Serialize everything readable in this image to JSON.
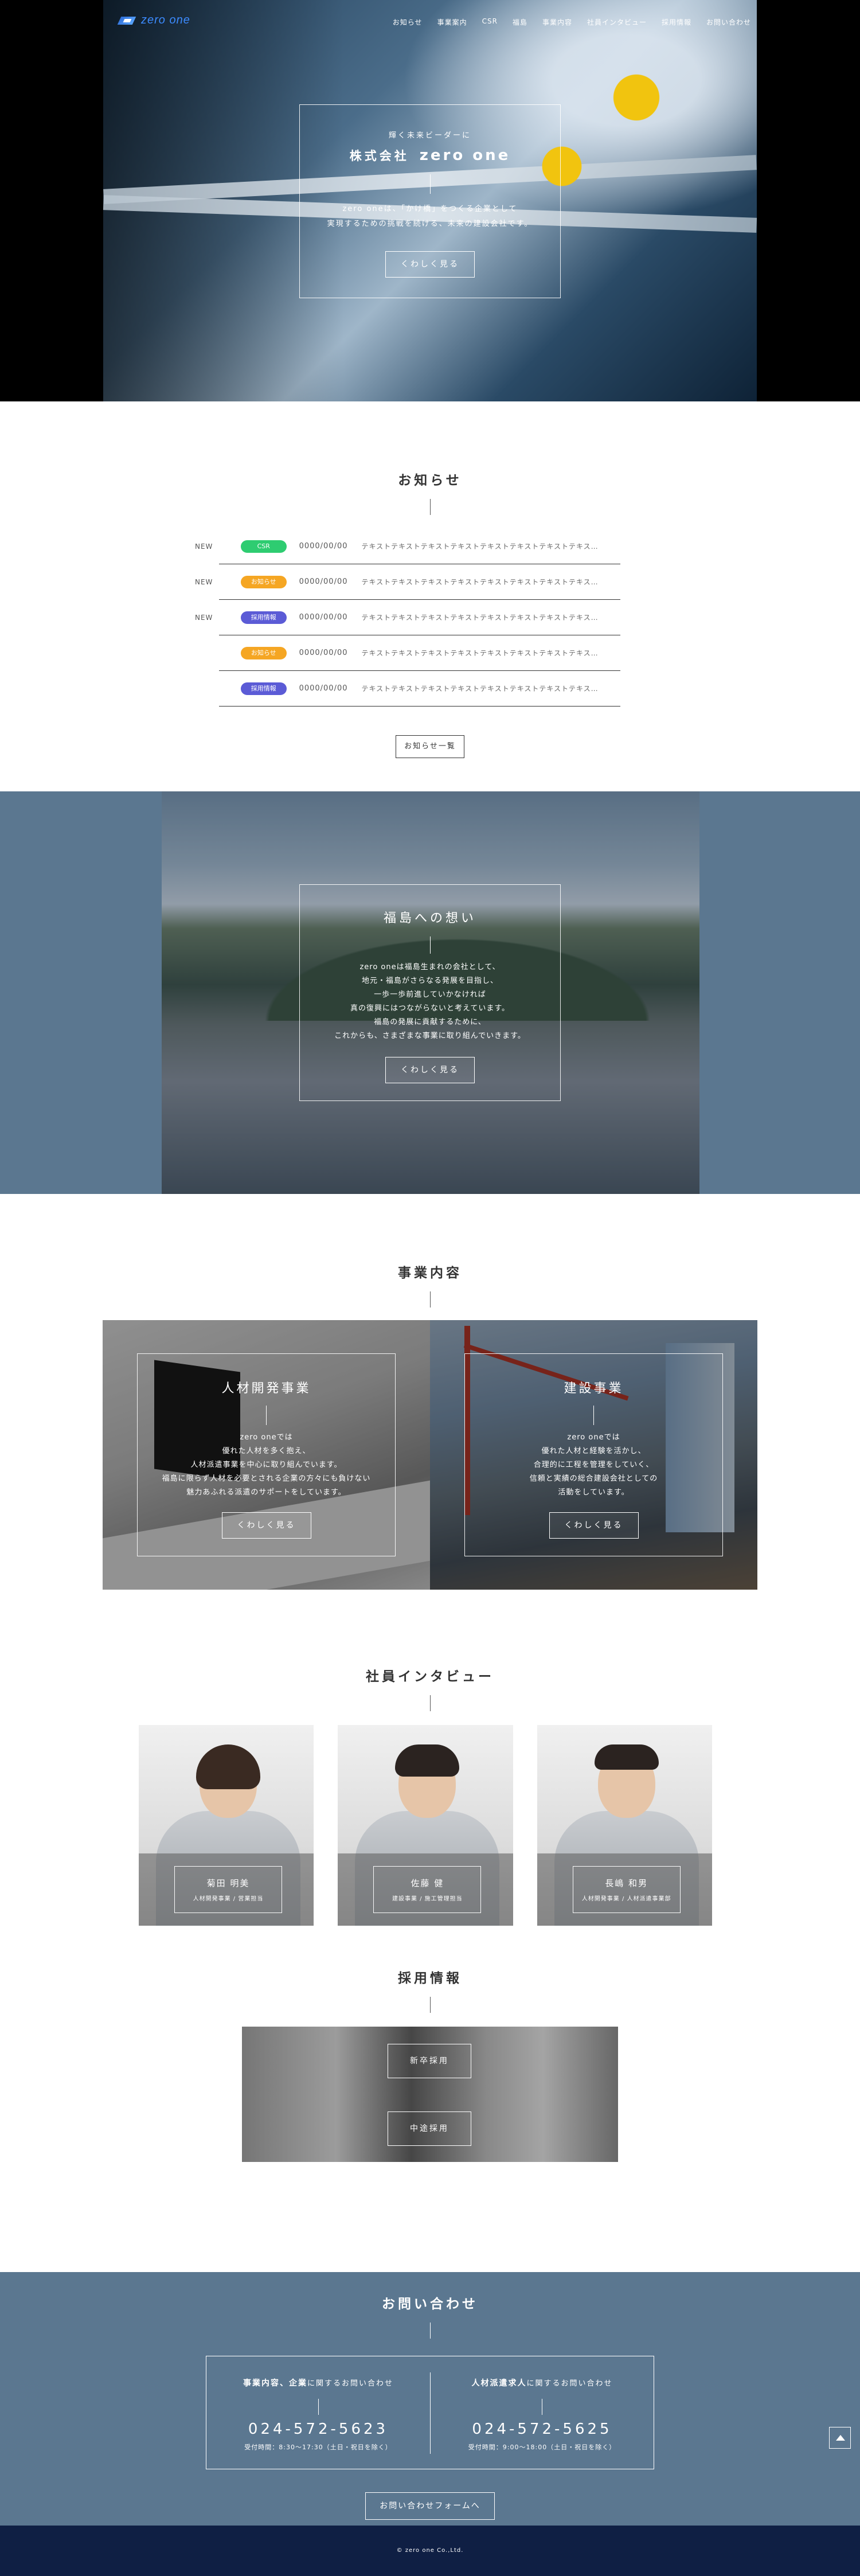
{
  "header": {
    "logo_text": "zero one",
    "nav": [
      "お知らせ",
      "事業案内",
      "CSR",
      "福島",
      "事業内容",
      "社員インタビュー",
      "採用情報",
      "お問い合わせ"
    ]
  },
  "hero": {
    "catch": "輝く未来ビーダーに",
    "company_prefix": "株式会社",
    "company_name": "zero one",
    "lead_1": "zero oneは、「かけ橋」をつくる企業として",
    "lead_2": "実現するための挑戦を続ける、未来の建設会社です。",
    "button": "くわしく見る"
  },
  "news": {
    "title": "お知らせ",
    "items": [
      {
        "new": "NEW",
        "category": "CSR",
        "color": "#2ecc71",
        "date": "0000/00/00",
        "text": "テキストテキストテキストテキストテキストテキストテキストテキス…"
      },
      {
        "new": "NEW",
        "category": "お知らせ",
        "color": "#f5a623",
        "date": "0000/00/00",
        "text": "テキストテキストテキストテキストテキストテキストテキストテキス…"
      },
      {
        "new": "NEW",
        "category": "採用情報",
        "color": "#5b5bd6",
        "date": "0000/00/00",
        "text": "テキストテキストテキストテキストテキストテキストテキストテキス…"
      },
      {
        "new": "",
        "category": "お知らせ",
        "color": "#f5a623",
        "date": "0000/00/00",
        "text": "テキストテキストテキストテキストテキストテキストテキストテキス…"
      },
      {
        "new": "",
        "category": "採用情報",
        "color": "#5b5bd6",
        "date": "0000/00/00",
        "text": "テキストテキストテキストテキストテキストテキストテキストテキス…"
      }
    ],
    "more_button": "お知らせ一覧"
  },
  "fukushima": {
    "title": "福島への想い",
    "lines": [
      "zero oneは福島生まれの会社として、",
      "地元・福島がさらなる発展を目指し、",
      "一歩一歩前進していかなければ",
      "真の復興にはつながらないと考えています。",
      "福島の発展に貢献するために、",
      "これからも、さまざまな事業に取り組んでいきます。"
    ],
    "button": "くわしく見る"
  },
  "business": {
    "title": "事業内容",
    "cards": [
      {
        "title": "人材開発事業",
        "lines": [
          "zero oneでは",
          "優れた人材を多く抱え、",
          "人材派遣事業を中心に取り組んでいます。",
          "福島に限らず人材を必要とされる企業の方々にも負けない",
          "魅力あふれる派遣のサポートをしています。"
        ],
        "button": "くわしく見る"
      },
      {
        "title": "建設事業",
        "lines": [
          "zero oneでは",
          "優れた人材と経験を活かし、",
          "合理的に工程を管理をしていく、",
          "信頼と実績の総合建設会社としての",
          "活動をしています。"
        ],
        "button": "くわしく見る"
      }
    ]
  },
  "interview": {
    "title": "社員インタビュー",
    "cards": [
      {
        "name": "菊田 明美",
        "role": "人材開発事業 / 営業担当"
      },
      {
        "name": "佐藤 健",
        "role": "建設事業 / 施工管理担当"
      },
      {
        "name": "長嶋 和男",
        "role": "人材開発事業 / 人材派遣事業部"
      }
    ]
  },
  "recruit": {
    "title": "採用情報",
    "buttons": [
      "新卒採用",
      "中途採用"
    ]
  },
  "contact": {
    "title": "お問い合わせ",
    "cols": [
      {
        "label_strong": "事業内容、企業",
        "label_rest": "に関するお問い合わせ",
        "tel": "024-572-5623",
        "hours": "受付時間：8:30〜17:30（土日・祝日を除く）"
      },
      {
        "label_strong": "人材派遣求人",
        "label_rest": "に関するお問い合わせ",
        "tel": "024-572-5625",
        "hours": "受付時間：9:00〜18:00（土日・祝日を除く）"
      }
    ],
    "form_button": "お問い合わせフォームへ"
  },
  "footer": {
    "copyright": "© zero one Co.,Ltd."
  }
}
